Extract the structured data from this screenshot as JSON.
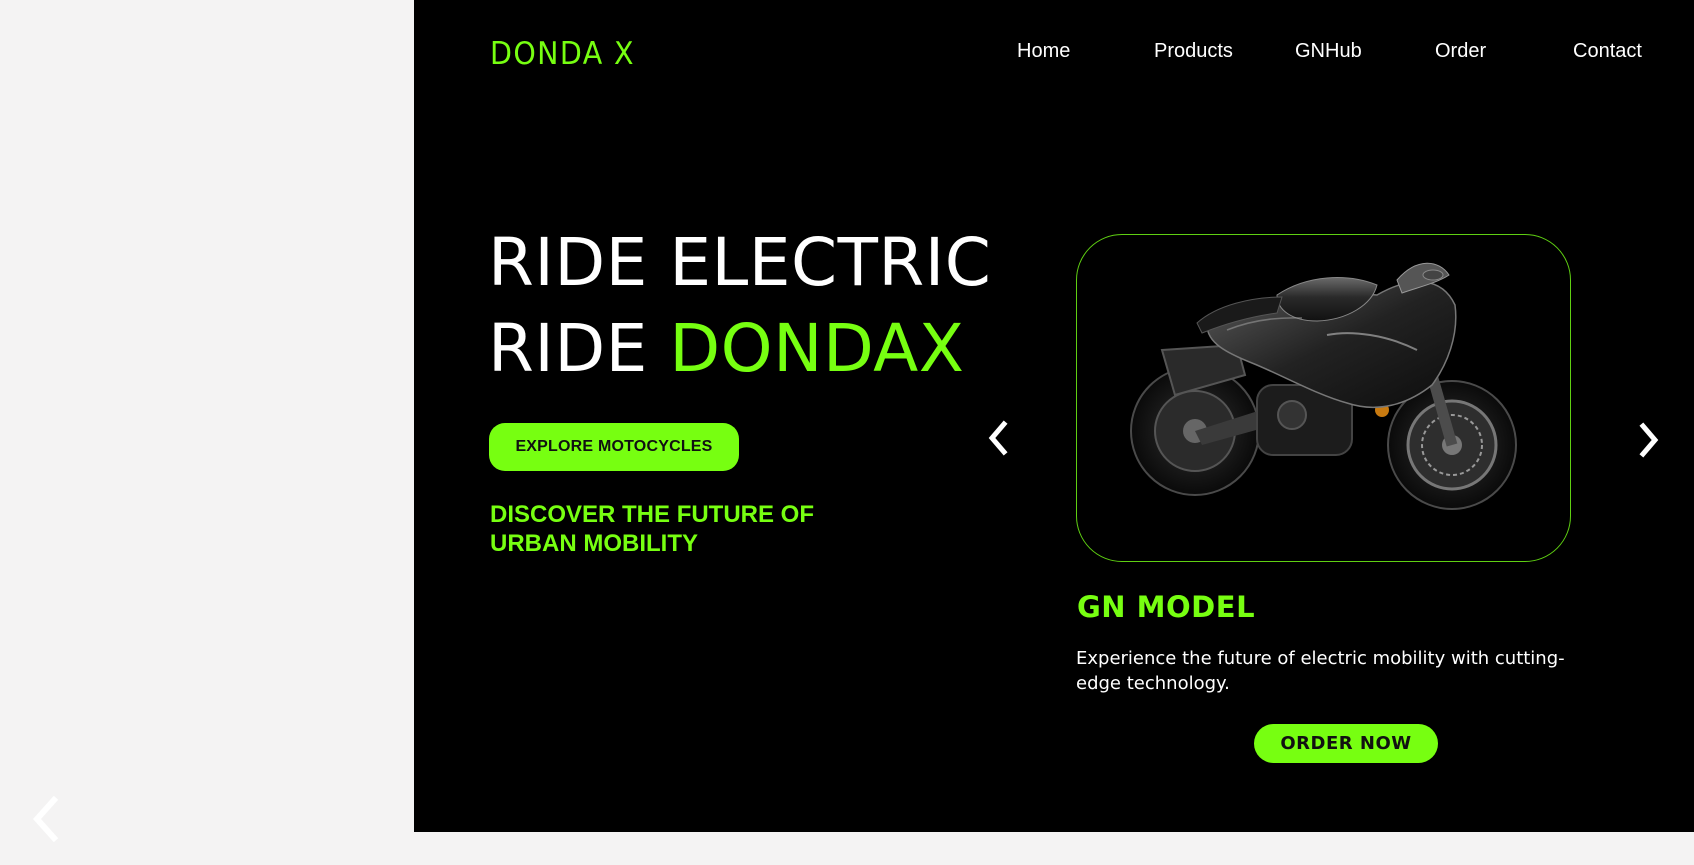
{
  "brand": {
    "name": "DONDA X"
  },
  "nav": {
    "items": [
      {
        "label": "Home"
      },
      {
        "label": "Products"
      },
      {
        "label": "GNHub"
      },
      {
        "label": "Order"
      },
      {
        "label": "Contact"
      }
    ]
  },
  "hero": {
    "line1": "RIDE ELECTRIC",
    "line2_prefix": "RIDE ",
    "line2_accent": "DONDAX",
    "explore_label": "EXPLORE MOTOCYCLES",
    "tagline": "DISCOVER THE  FUTURE OF\nURBAN MOBILITY"
  },
  "product": {
    "name": "GN MODEL",
    "description": "Experience the future of electric mobility with cutting-edge technology.",
    "order_label": "ORDER NOW",
    "image": "black-sport-motorcycle"
  },
  "icons": {
    "prev": "chevron-left-icon",
    "next": "chevron-right-icon"
  },
  "colors": {
    "accent": "#77ff11",
    "panel_bg": "#000000",
    "page_bg": "#f4f3f3",
    "card_border": "#5fd012"
  }
}
